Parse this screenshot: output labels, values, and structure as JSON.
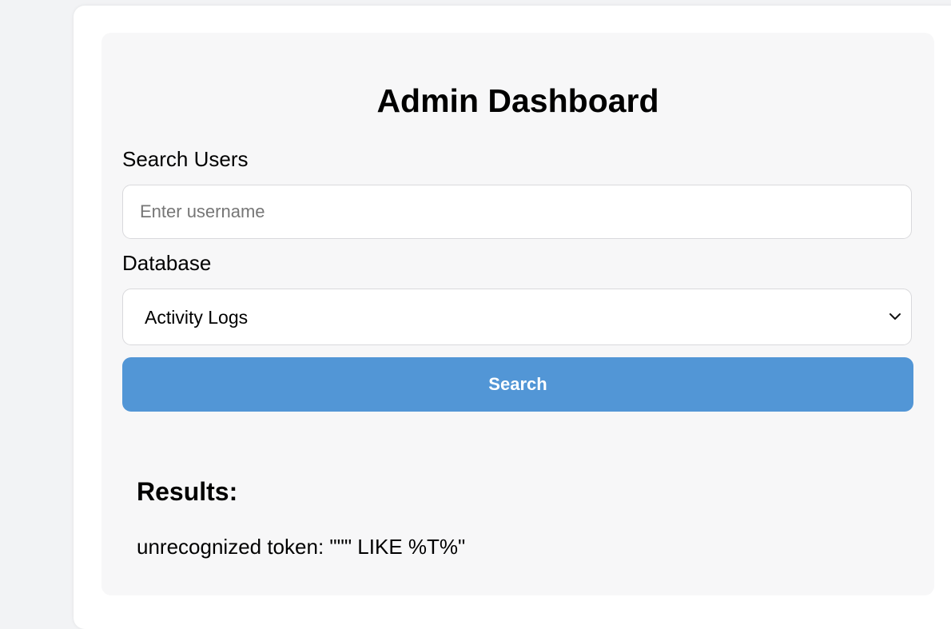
{
  "page": {
    "title": "Admin Dashboard"
  },
  "search": {
    "label": "Search Users",
    "placeholder": "Enter username",
    "value": ""
  },
  "database": {
    "label": "Database",
    "selected": "Activity Logs"
  },
  "actions": {
    "search_label": "Search"
  },
  "results": {
    "heading": "Results:",
    "message": "unrecognized token: \"\"\" LIKE %T%\""
  },
  "colors": {
    "accent": "#5296d6",
    "panel": "#f7f7f8",
    "background": "#f2f3f5"
  },
  "icons": {
    "select_indicator": "chevron-down-icon"
  }
}
